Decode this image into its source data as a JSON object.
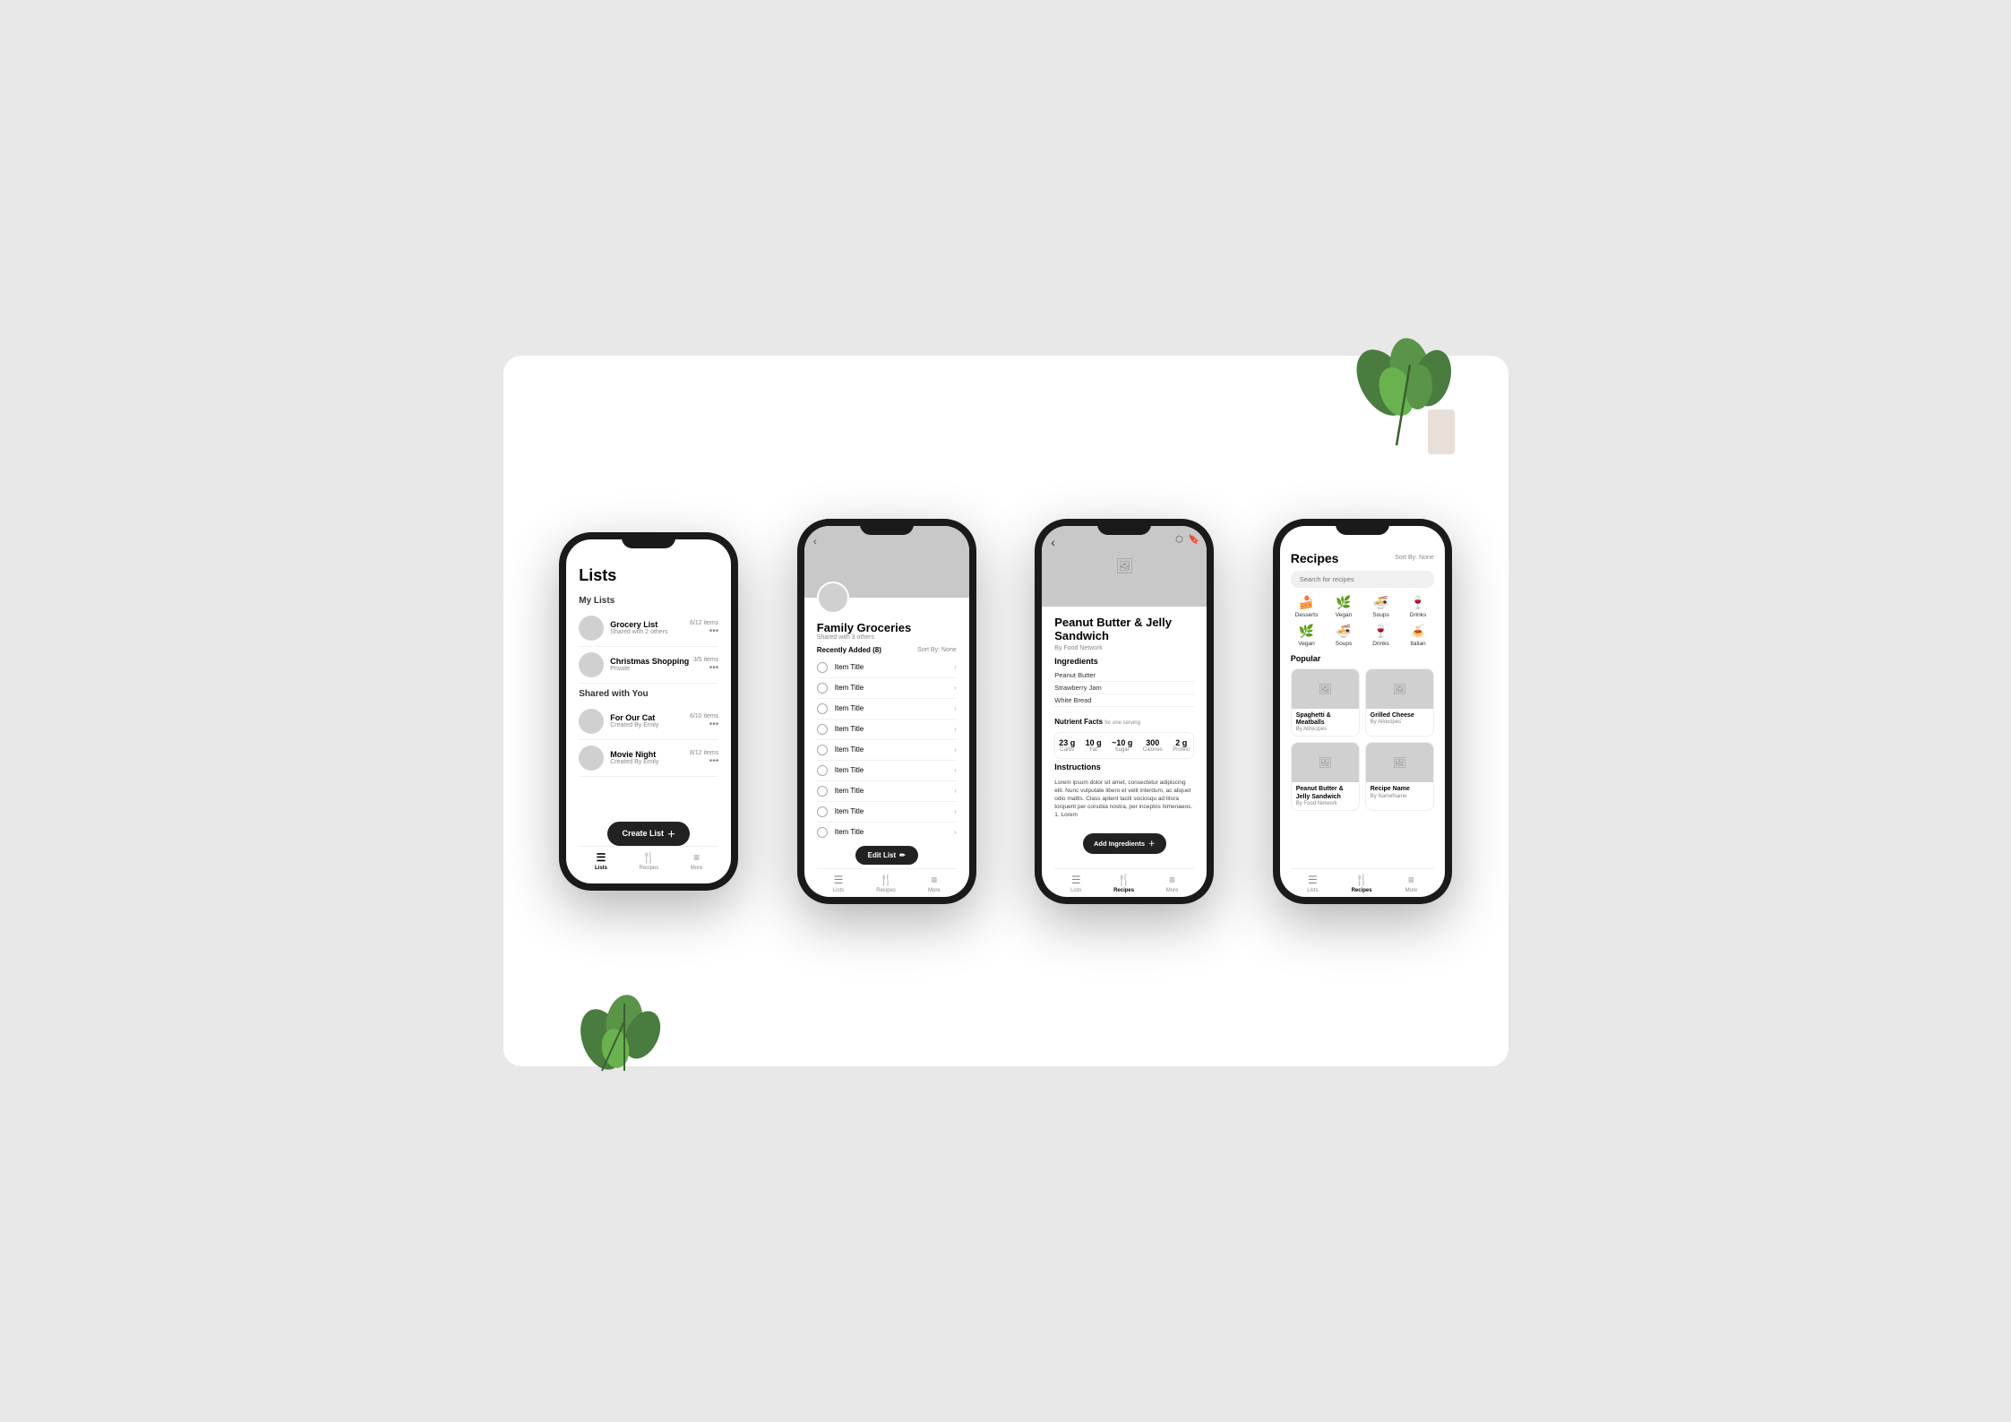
{
  "scene": {
    "background": "white"
  },
  "phone1": {
    "title": "Lists",
    "myListsLabel": "My Lists",
    "sharedWithYouLabel": "Shared with You",
    "myLists": [
      {
        "name": "Grocery List",
        "sub": "Shared with 2 others",
        "count": "8/12 items"
      },
      {
        "name": "Christmas Shopping",
        "sub": "Private",
        "count": "3/5 items"
      }
    ],
    "sharedLists": [
      {
        "name": "For Our Cat",
        "sub": "Created By Emily",
        "count": "6/10 items"
      },
      {
        "name": "Movie Night",
        "sub": "Created By Emily",
        "count": "8/12 items"
      }
    ],
    "createListBtn": "Create List",
    "nav": [
      {
        "label": "Lists",
        "active": true
      },
      {
        "label": "Recipes",
        "active": false
      },
      {
        "label": "More",
        "active": false
      }
    ]
  },
  "phone2": {
    "title": "Family Groceries",
    "sharedWith": "Shared with 3 others",
    "sortBy": "Sort By: None",
    "recentlyAdded": "Recently Added (8)",
    "items": [
      "Item Title",
      "Item Title",
      "Item Title",
      "Item Title",
      "Item Title",
      "Item Title",
      "Item Title",
      "Item Title",
      "Item Title"
    ],
    "editListBtn": "Edit List",
    "nav": [
      {
        "label": "Lists",
        "active": false
      },
      {
        "label": "Recipes",
        "active": false
      },
      {
        "label": "More",
        "active": false
      }
    ]
  },
  "phone3": {
    "recipeTitle": "Peanut Butter & Jelly Sandwich",
    "recipeBy": "By Food Network",
    "ingredientsLabel": "Ingredients",
    "ingredients": [
      "Peanut Butter",
      "Strawberry Jam",
      "White Bread"
    ],
    "nutrientFactsLabel": "Nutrient Facts",
    "nutrientFactsSub": "for one serving",
    "nutrients": [
      {
        "val": "23 g",
        "label": "Carbs"
      },
      {
        "val": "10 g",
        "label": "Fat"
      },
      {
        "val": "~10 g",
        "label": "Sugar"
      },
      {
        "val": "300",
        "label": "Calories"
      },
      {
        "val": "2 g",
        "label": "Protein"
      }
    ],
    "instructionsLabel": "Instructions",
    "instructions": "Lorem ipsum dolor sit amet, consectetur adipiscing elit. Nunc vulputate libero et velit interdum, ac aliquet odio mattis. Class aptent taciti sociosqu ad litora torquent per conubia nostra, per inceptos himenaeos. 1. Lorem",
    "addIngredientsBtn": "Add Ingredients",
    "nav": [
      {
        "label": "Lists",
        "active": false
      },
      {
        "label": "Recipes",
        "active": true
      },
      {
        "label": "More",
        "active": false
      }
    ]
  },
  "phone4": {
    "title": "Recipes",
    "sortBy": "Sort By: None",
    "searchPlaceholder": "Search for recipes",
    "categories": [
      {
        "label": "Desserts",
        "icon": "🍰"
      },
      {
        "label": "Vegan",
        "icon": "🌿"
      },
      {
        "label": "Soups",
        "icon": "🍜"
      },
      {
        "label": "Drinks",
        "icon": "🍷"
      },
      {
        "label": "Vegan",
        "icon": "🌿"
      },
      {
        "label": "Soups",
        "icon": "🍜"
      },
      {
        "label": "Drinks",
        "icon": "🍷"
      },
      {
        "label": "Italian",
        "icon": "🍝"
      }
    ],
    "popularLabel": "Popular",
    "recipes": [
      {
        "name": "Spaghetti & Meatballs",
        "by": "By Allrecipes"
      },
      {
        "name": "Grilled Cheese",
        "by": "By Allrecipes"
      },
      {
        "name": "Peanut Butter & Jelly Sandwich",
        "by": "By Food Network"
      },
      {
        "name": "Recipe Name",
        "by": "By NameName"
      }
    ],
    "nav": [
      {
        "label": "Lists",
        "active": false
      },
      {
        "label": "Recipes",
        "active": true
      },
      {
        "label": "More",
        "active": false
      }
    ]
  }
}
